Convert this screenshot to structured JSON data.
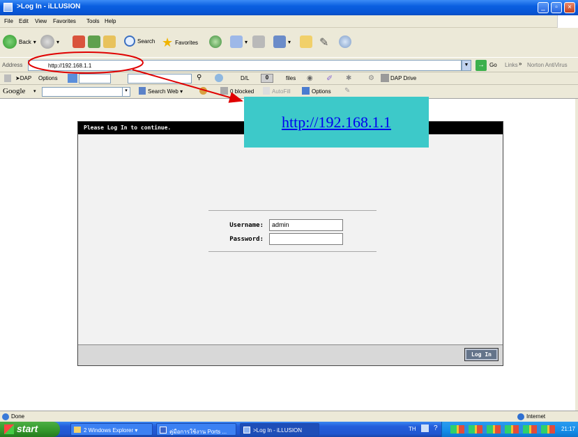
{
  "window": {
    "title": ">Log In - iLLUSION"
  },
  "menu": {
    "items": [
      "File",
      "Edit",
      "View",
      "Favorites",
      "Tools",
      "Help"
    ]
  },
  "toolbar": {
    "back_label": "Back",
    "search_label": "Search",
    "favorites_label": "Favorites"
  },
  "address": {
    "label": "Address",
    "url": "http://192.168.1.1",
    "go_label": "Go",
    "links_label": "Links",
    "norton_label": "Norton AntiVirus"
  },
  "linkbar": {
    "dap_label": "DAP",
    "options_label": "Options",
    "dl_label": "D/L",
    "files_count": "0",
    "files_label": "files",
    "dap_drive_label": "DAP Drive"
  },
  "google": {
    "logo": "Google",
    "search_web_label": "Search Web",
    "blocked_label": "0 blocked",
    "autofill_label": "AutoFill",
    "options_label": "Options"
  },
  "login": {
    "header": "Please Log In to continue.",
    "username_label": "Username:",
    "username_value": "admin",
    "password_label": "Password:",
    "password_value": "",
    "button_label": "Log In"
  },
  "callout": {
    "text": "http://192.168.1.1",
    "bg_color": "#3dc9c9"
  },
  "status": {
    "text": "Done",
    "zone": "Internet"
  },
  "taskbar": {
    "start_label": "start",
    "tasks": [
      "2 Windows Explorer",
      "คู่มือการใช้งาน Ports ...",
      ">Log In - iLLUSION"
    ],
    "lang": "TH",
    "clock": "21:17"
  }
}
